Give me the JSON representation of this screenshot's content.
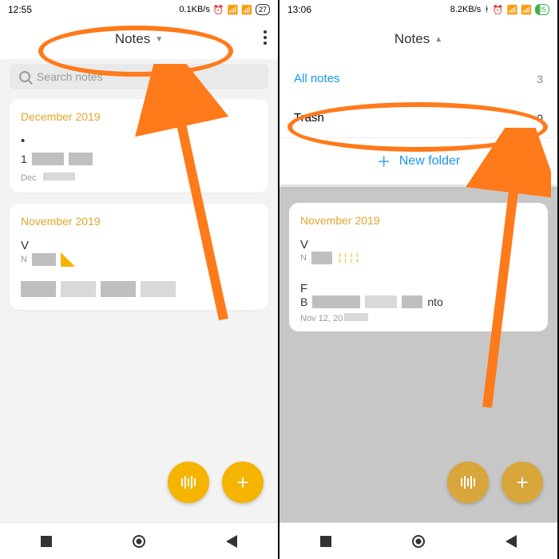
{
  "left": {
    "status": {
      "time": "12:55",
      "net": "0.1KB/s",
      "batt": "27"
    },
    "header": {
      "title": "Notes"
    },
    "search": {
      "placeholder": "Search notes"
    },
    "groups": [
      {
        "title": "December 2019",
        "items": [
          {
            "line1_text": "",
            "sub": "Dec"
          }
        ]
      },
      {
        "title": "November 2019",
        "items": [
          {
            "prefix": "V",
            "sub": "N"
          },
          {
            "blocks": true
          }
        ]
      }
    ]
  },
  "right": {
    "status": {
      "time": "13:06",
      "net": "8.2KB/s",
      "batt": "25"
    },
    "header": {
      "title": "Notes"
    },
    "dropdown": {
      "all_label": "All notes",
      "all_count": "3",
      "trash_label": "Trash",
      "trash_count": "0",
      "new_folder": "New folder"
    },
    "dim_group_title": "November 2019",
    "dim_sub_text": "Nov 12, 20",
    "dim_note_suffix": "nto"
  }
}
